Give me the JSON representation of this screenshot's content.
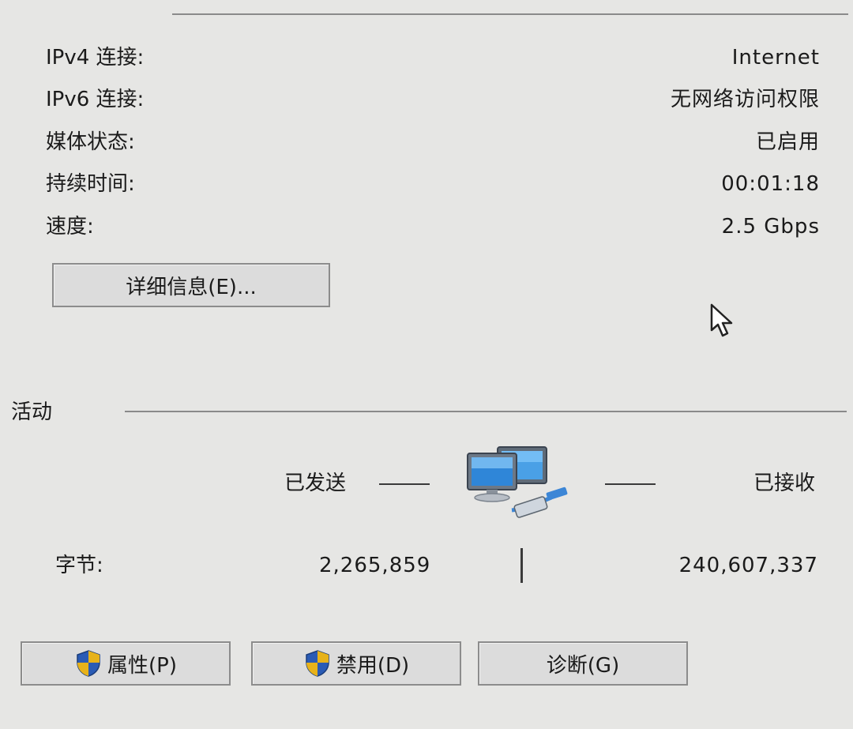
{
  "connection": {
    "rows": [
      {
        "label": "IPv4 连接:",
        "value": "Internet"
      },
      {
        "label": "IPv6 连接:",
        "value": "无网络访问权限"
      },
      {
        "label": "媒体状态:",
        "value": "已启用"
      },
      {
        "label": "持续时间:",
        "value": "00:01:18"
      },
      {
        "label": "速度:",
        "value": "2.5 Gbps"
      }
    ],
    "details_button": "详细信息(E)..."
  },
  "activity": {
    "group_label": "活动",
    "sent_label": "已发送",
    "received_label": "已接收",
    "bytes_label": "字节:",
    "bytes_sent": "2,265,859",
    "bytes_received": "240,607,337",
    "icon": "network-computers-icon"
  },
  "buttons": {
    "properties": "属性(P)",
    "disable": "禁用(D)",
    "diagnose": "诊断(G)",
    "shield_icon": "uac-shield-icon"
  },
  "colors": {
    "background": "#e6e6e4",
    "shield_blue": "#2a5bb5",
    "shield_gold": "#e7b21a"
  }
}
